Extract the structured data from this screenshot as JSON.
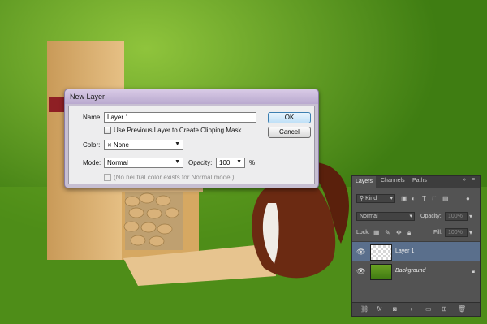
{
  "dialog": {
    "title": "New Layer",
    "name_label": "Name:",
    "name_value": "Layer 1",
    "clip_label": "Use Previous Layer to Create Clipping Mask",
    "color_label": "Color:",
    "color_value": "None",
    "mode_label": "Mode:",
    "mode_value": "Normal",
    "opacity_label": "Opacity:",
    "opacity_value": "100",
    "opacity_unit": "%",
    "neutral_note": "(No neutral color exists for Normal mode.)",
    "ok_label": "OK",
    "cancel_label": "Cancel"
  },
  "panel": {
    "tabs": [
      "Layers",
      "Channels",
      "Paths"
    ],
    "kind_label": "Kind",
    "blend_mode": "Normal",
    "opacity_label": "Opacity:",
    "opacity_value": "100%",
    "lock_label": "Lock:",
    "fill_label": "Fill:",
    "fill_value": "100%",
    "layers": [
      {
        "name": "Layer 1",
        "selected": true
      },
      {
        "name": "Background",
        "selected": false
      }
    ]
  },
  "colors": {
    "dialog_frame": "#c7bfd2",
    "panel_bg": "#535353",
    "selected_layer": "#5a6f8c"
  }
}
